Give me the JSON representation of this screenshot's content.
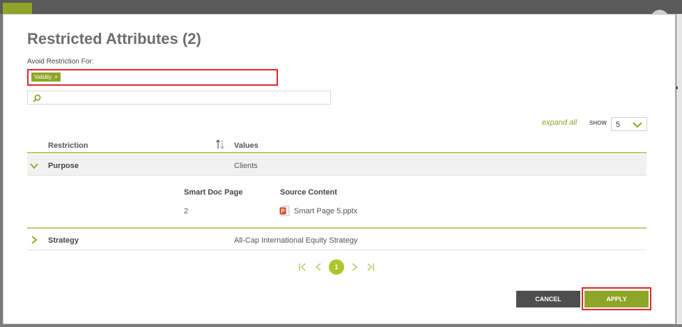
{
  "dialog": {
    "title": "Restricted Attributes (2)",
    "avoid_label": "Avoid Restriction For:",
    "tags": [
      {
        "label": "Validity",
        "remove": "×"
      }
    ],
    "search": {
      "value": "",
      "placeholder": ""
    }
  },
  "toolbar": {
    "expand_all": "expand all",
    "show_label": "SHOW",
    "show_value": "5"
  },
  "table": {
    "columns": {
      "restriction": "Restriction",
      "values": "Values"
    },
    "rows": [
      {
        "restriction": "Purpose",
        "value": "Clients",
        "expanded": true,
        "detail": {
          "columns": {
            "page": "Smart Doc Page",
            "source": "Source Content"
          },
          "rows": [
            {
              "page": "2",
              "source": "Smart Page 5.pptx"
            }
          ]
        }
      },
      {
        "restriction": "Strategy",
        "value": "All-Cap International Equity Strategy",
        "expanded": false
      }
    ]
  },
  "pagination": {
    "current": "1"
  },
  "buttons": {
    "cancel": "CANCEL",
    "apply": "APPLY"
  },
  "colors": {
    "accent": "#8fa527",
    "highlight": "#e0252e",
    "cancel_bg": "#4e4e4e"
  }
}
